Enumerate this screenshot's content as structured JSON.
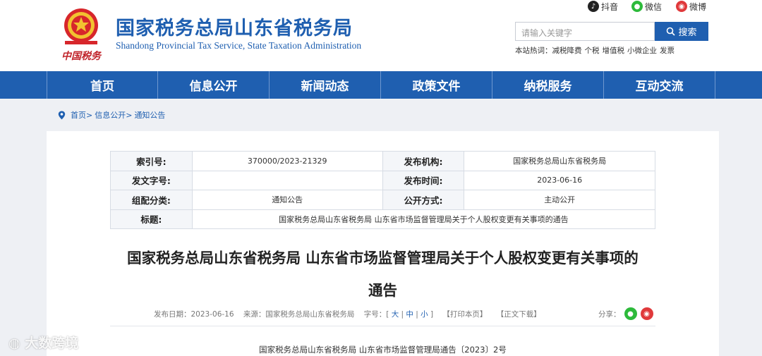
{
  "header": {
    "emblem_caption": "中国税务",
    "title": "国家税务总局山东省税务局",
    "subtitle": "Shandong Provincial Tax Service, State Taxation Administration",
    "social": [
      {
        "label": "抖音",
        "icon": "douyin-icon"
      },
      {
        "label": "微信",
        "icon": "wechat-icon"
      },
      {
        "label": "微博",
        "icon": "weibo-icon"
      }
    ],
    "search": {
      "placeholder": "请输入关键字",
      "button": "搜索"
    },
    "hot_label": "本站热词：",
    "hot_words": [
      "减税降费",
      "个税",
      "增值税",
      "小微企业",
      "发票"
    ]
  },
  "nav": [
    "首页",
    "信息公开",
    "新闻动态",
    "政策文件",
    "纳税服务",
    "互动交流"
  ],
  "breadcrumb": [
    "首页>",
    "信息公开>",
    "通知公告"
  ],
  "meta": {
    "index_no_label": "索引号:",
    "index_no": "370000/2023-21329",
    "org_label": "发布机构:",
    "org": "国家税务总局山东省税务局",
    "doc_no_label": "发文字号:",
    "doc_no": "",
    "date_label": "发布时间:",
    "date": "2023-06-16",
    "category_label": "组配分类:",
    "category": "通知公告",
    "open_label": "公开方式:",
    "open": "主动公开",
    "title_label": "标题:",
    "title": "国家税务总局山东省税务局 山东省市场监督管理局关于个人股权变更有关事项的通告"
  },
  "article": {
    "title_line1": "国家税务总局山东省税务局 山东省市场监督管理局关于个人股权变更有关事项的",
    "title_line2": "通告",
    "date_text": "发布日期：2023-06-16",
    "source_text": "来源：国家税务总局山东省税务局",
    "font_label": "字号：",
    "font_large": "大",
    "font_medium": "中",
    "font_small": "小",
    "print": "【打印本页】",
    "download": "【正文下载】",
    "share_label": "分享：",
    "doc_number": "国家税务总局山东省税务局 山东省市场监督管理局通告〔2023〕2号"
  },
  "watermark": "大数跨境",
  "colors": {
    "brand_blue": "#1f5fb0",
    "wechat_green": "#2dba3b",
    "weibo_red": "#e0393b"
  }
}
